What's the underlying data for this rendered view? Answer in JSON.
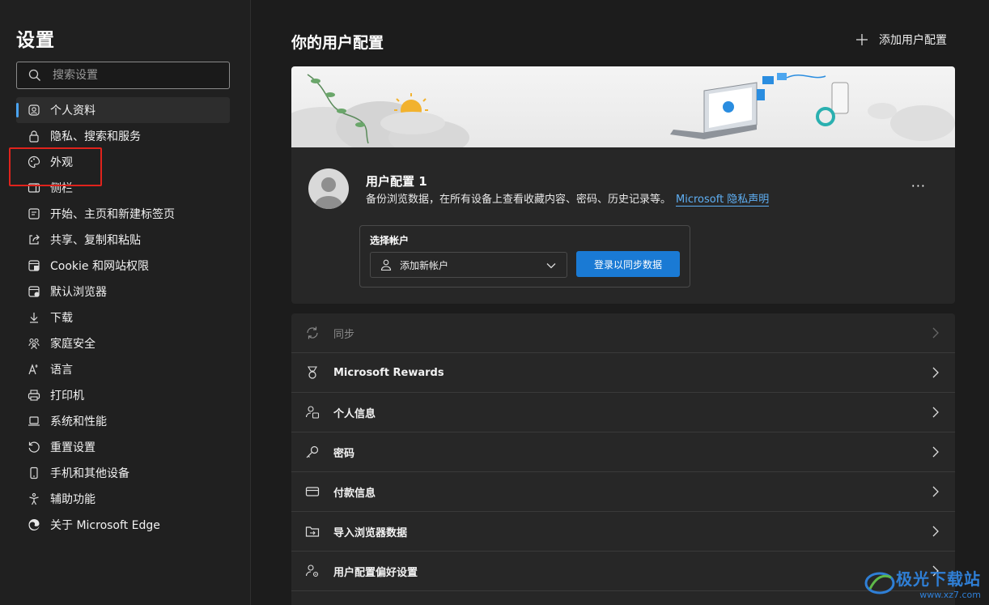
{
  "sidebar": {
    "title": "设置",
    "search_placeholder": "搜索设置",
    "items": [
      {
        "label": "个人资料",
        "icon": "profile-icon",
        "active": true
      },
      {
        "label": "隐私、搜索和服务",
        "icon": "lock-icon"
      },
      {
        "label": "外观",
        "icon": "palette-icon"
      },
      {
        "label": "侧栏",
        "icon": "sidebar-icon"
      },
      {
        "label": "开始、主页和新建标签页",
        "icon": "home-icon"
      },
      {
        "label": "共享、复制和粘贴",
        "icon": "share-icon"
      },
      {
        "label": "Cookie 和网站权限",
        "icon": "cookie-icon"
      },
      {
        "label": "默认浏览器",
        "icon": "browser-icon"
      },
      {
        "label": "下载",
        "icon": "download-icon"
      },
      {
        "label": "家庭安全",
        "icon": "family-icon"
      },
      {
        "label": "语言",
        "icon": "language-icon"
      },
      {
        "label": "打印机",
        "icon": "printer-icon"
      },
      {
        "label": "系统和性能",
        "icon": "laptop-icon"
      },
      {
        "label": "重置设置",
        "icon": "reset-icon"
      },
      {
        "label": "手机和其他设备",
        "icon": "phone-icon"
      },
      {
        "label": "辅助功能",
        "icon": "accessibility-icon"
      },
      {
        "label": "关于 Microsoft Edge",
        "icon": "edge-icon"
      }
    ]
  },
  "main": {
    "title": "你的用户配置",
    "add_profile_label": "添加用户配置",
    "profile": {
      "name": "用户配置 1",
      "description": "备份浏览数据，在所有设备上查看收藏内容、密码、历史记录等。",
      "privacy_link": "Microsoft 隐私声明",
      "more_label": "···",
      "account_label": "选择帐户",
      "account_select_value": "添加新帐户",
      "signin_button": "登录以同步数据"
    },
    "rows": [
      {
        "label": "同步",
        "icon": "sync-icon",
        "disabled": true
      },
      {
        "label": "Microsoft Rewards",
        "icon": "rewards-icon"
      },
      {
        "label": "个人信息",
        "icon": "personal-info-icon"
      },
      {
        "label": "密码",
        "icon": "key-icon"
      },
      {
        "label": "付款信息",
        "icon": "card-icon"
      },
      {
        "label": "导入浏览器数据",
        "icon": "import-icon"
      },
      {
        "label": "用户配置偏好设置",
        "icon": "profile-prefs-icon"
      }
    ]
  },
  "watermark": {
    "text": "极光下载站",
    "url": "www.xz7.com"
  },
  "colors": {
    "accent": "#1a7ad4",
    "link": "#5fb0f5",
    "highlight": "#e0231c"
  }
}
